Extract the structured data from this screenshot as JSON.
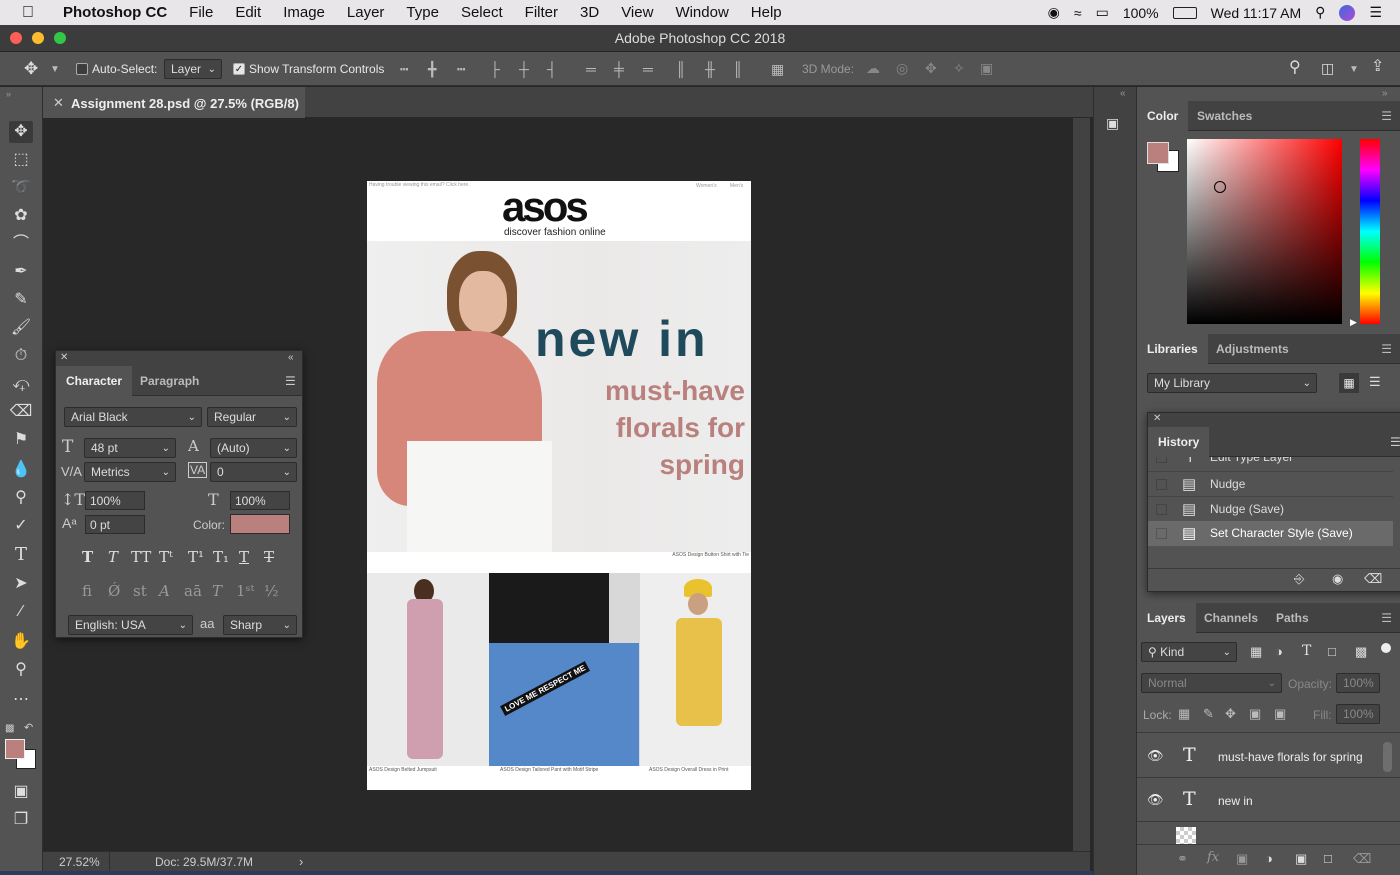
{
  "menubar": {
    "app": "Photoshop CC",
    "items": [
      "File",
      "Edit",
      "Image",
      "Layer",
      "Type",
      "Select",
      "Filter",
      "3D",
      "View",
      "Window",
      "Help"
    ],
    "battery": "100%",
    "clock": "Wed 11:17 AM"
  },
  "window": {
    "title": "Adobe Photoshop CC 2018"
  },
  "options": {
    "auto_select_label": "Auto-Select:",
    "auto_select_value": "Layer",
    "show_transform": "Show Transform Controls",
    "mode3d": "3D Mode:"
  },
  "doc_tab": {
    "title": "Assignment 28.psd @ 27.5% (RGB/8)"
  },
  "status": {
    "zoom": "27.52%",
    "doc": "Doc: 29.5M/37.7M"
  },
  "document": {
    "preheader": "Having trouble viewing this email? Click here.",
    "nav_women": "Women's",
    "nav_men": "Men's",
    "logo": "asos",
    "tagline": "discover fashion online",
    "headline": "new in",
    "sub1": "must-have",
    "sub2": "florals for",
    "sub3": "spring",
    "caption_hero": "ASOS Design Button Shirt with Tie",
    "caption_1": "ASOS Design Belted Jumpsuit",
    "caption_2": "ASOS Design Tailored Pant with Motif Stripe",
    "caption_3": "ASOS Design Overall Dress in Print",
    "ribbon": "LOVE ME RESPECT ME"
  },
  "character": {
    "tab1": "Character",
    "tab2": "Paragraph",
    "font": "Arial Black",
    "style": "Regular",
    "size": "48 pt",
    "leading": "(Auto)",
    "kerning": "Metrics",
    "tracking": "0",
    "vscale": "100%",
    "hscale": "100%",
    "baseline": "0 pt",
    "color_label": "Color:",
    "language": "English: USA",
    "antialias_icon": "aa",
    "antialias": "Sharp",
    "color": "#b9807d"
  },
  "color_panel": {
    "tab1": "Color",
    "tab2": "Swatches",
    "fg": "#b9807d"
  },
  "libraries": {
    "tab1": "Libraries",
    "tab2": "Adjustments",
    "library": "My Library"
  },
  "history": {
    "title": "History",
    "items": [
      "Edit Type Layer",
      "Nudge",
      "Nudge (Save)",
      "Set Character Style (Save)"
    ]
  },
  "layers": {
    "tab1": "Layers",
    "tab2": "Channels",
    "tab3": "Paths",
    "kind": "Kind",
    "blend": "Normal",
    "opacity_label": "Opacity:",
    "opacity": "100%",
    "lock_label": "Lock:",
    "fill_label": "Fill:",
    "fill": "100%",
    "items": [
      "must-have florals for spring",
      "new in"
    ]
  }
}
